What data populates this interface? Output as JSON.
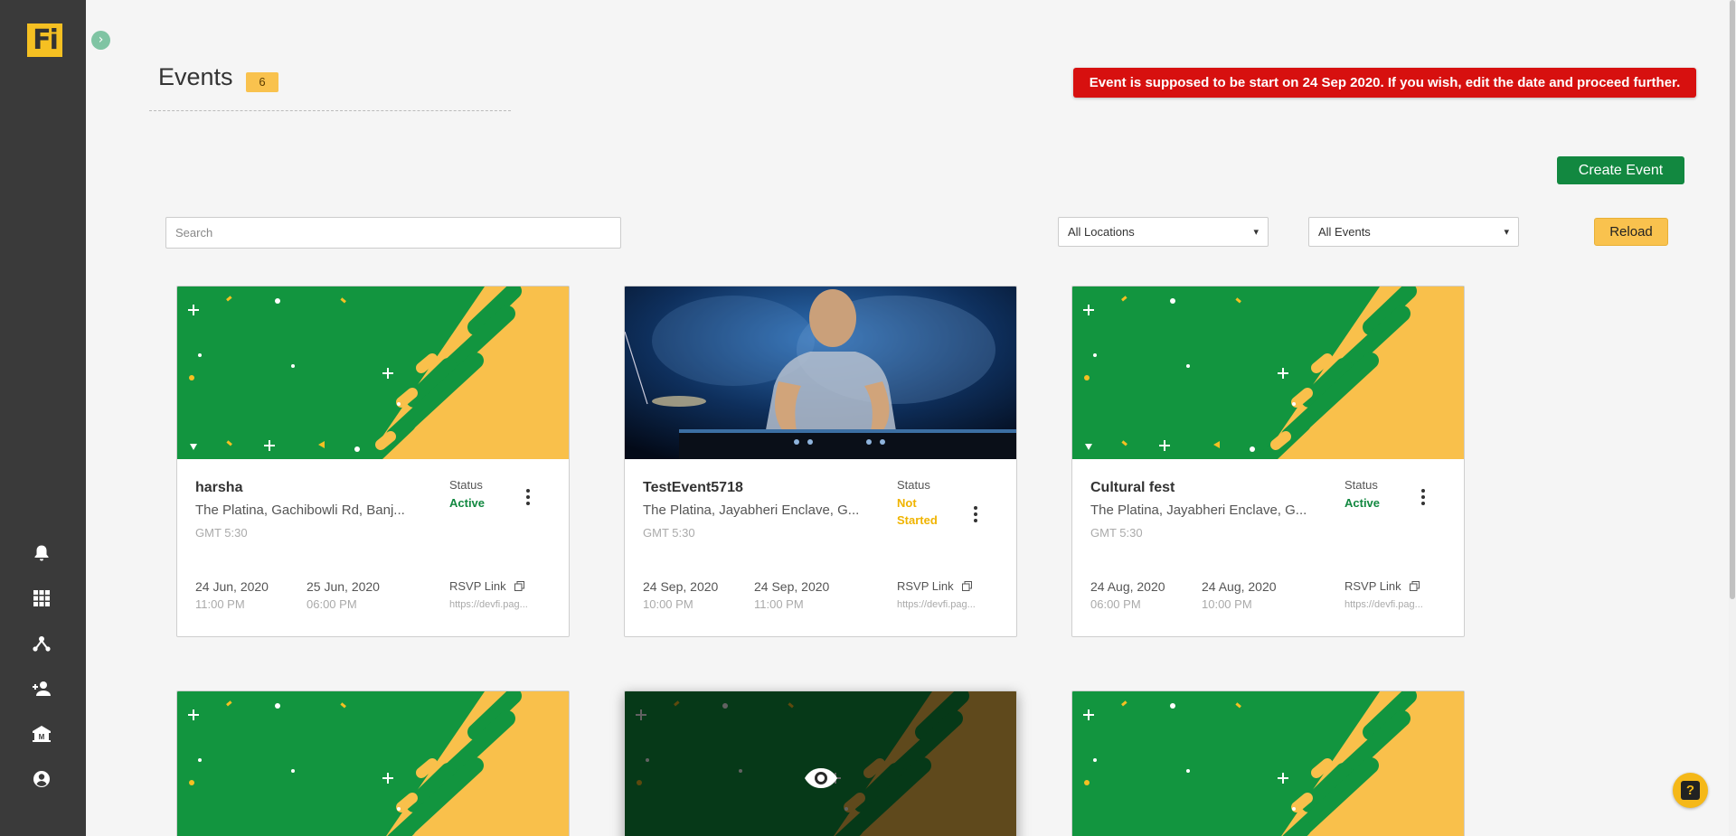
{
  "app": {
    "logo_text": "Fi"
  },
  "sidebar": {
    "items": [
      {
        "name": "bell-icon"
      },
      {
        "name": "grid-icon"
      },
      {
        "name": "hierarchy-icon"
      },
      {
        "name": "add-user-icon"
      },
      {
        "name": "institution-icon"
      },
      {
        "name": "account-icon"
      }
    ]
  },
  "header": {
    "title": "Events",
    "count": "6",
    "alert": "Event is supposed to be start on 24 Sep 2020. If you wish, edit the date and proceed further.",
    "create_label": "Create Event"
  },
  "filters": {
    "search_placeholder": "Search",
    "location_selected": "All Locations",
    "events_selected": "All Events",
    "reload_label": "Reload"
  },
  "events": [
    {
      "name": "harsha",
      "address": "The Platina, Gachibowli Rd, Banj...",
      "timezone": "GMT 5:30",
      "status_label": "Status",
      "status": "Active",
      "start_date": "24 Jun, 2020",
      "start_time": "11:00 PM",
      "end_date": "25 Jun, 2020",
      "end_time": "06:00 PM",
      "rsvp_label": "RSVP Link",
      "rsvp_url": "https://devfi.pag..."
    },
    {
      "name": "TestEvent5718",
      "address": "The Platina, Jayabheri Enclave, G...",
      "timezone": "GMT 5:30",
      "status_label": "Status",
      "status": "Not Started",
      "start_date": "24 Sep, 2020",
      "start_time": "10:00 PM",
      "end_date": "24 Sep, 2020",
      "end_time": "11:00 PM",
      "rsvp_label": "RSVP Link",
      "rsvp_url": "https://devfi.pag..."
    },
    {
      "name": "Cultural fest",
      "address": "The Platina, Jayabheri Enclave, G...",
      "timezone": "GMT 5:30",
      "status_label": "Status",
      "status": "Active",
      "start_date": "24 Aug, 2020",
      "start_time": "06:00 PM",
      "end_date": "24 Aug, 2020",
      "end_time": "10:00 PM",
      "rsvp_label": "RSVP Link",
      "rsvp_url": "https://devfi.pag..."
    }
  ],
  "colors": {
    "sidebar": "#3a3a3a",
    "brand_yellow": "#f5c022",
    "brand_green": "#128840",
    "alert_red": "#d7100f",
    "status_active": "#128840",
    "status_not_started": "#f0b400"
  }
}
